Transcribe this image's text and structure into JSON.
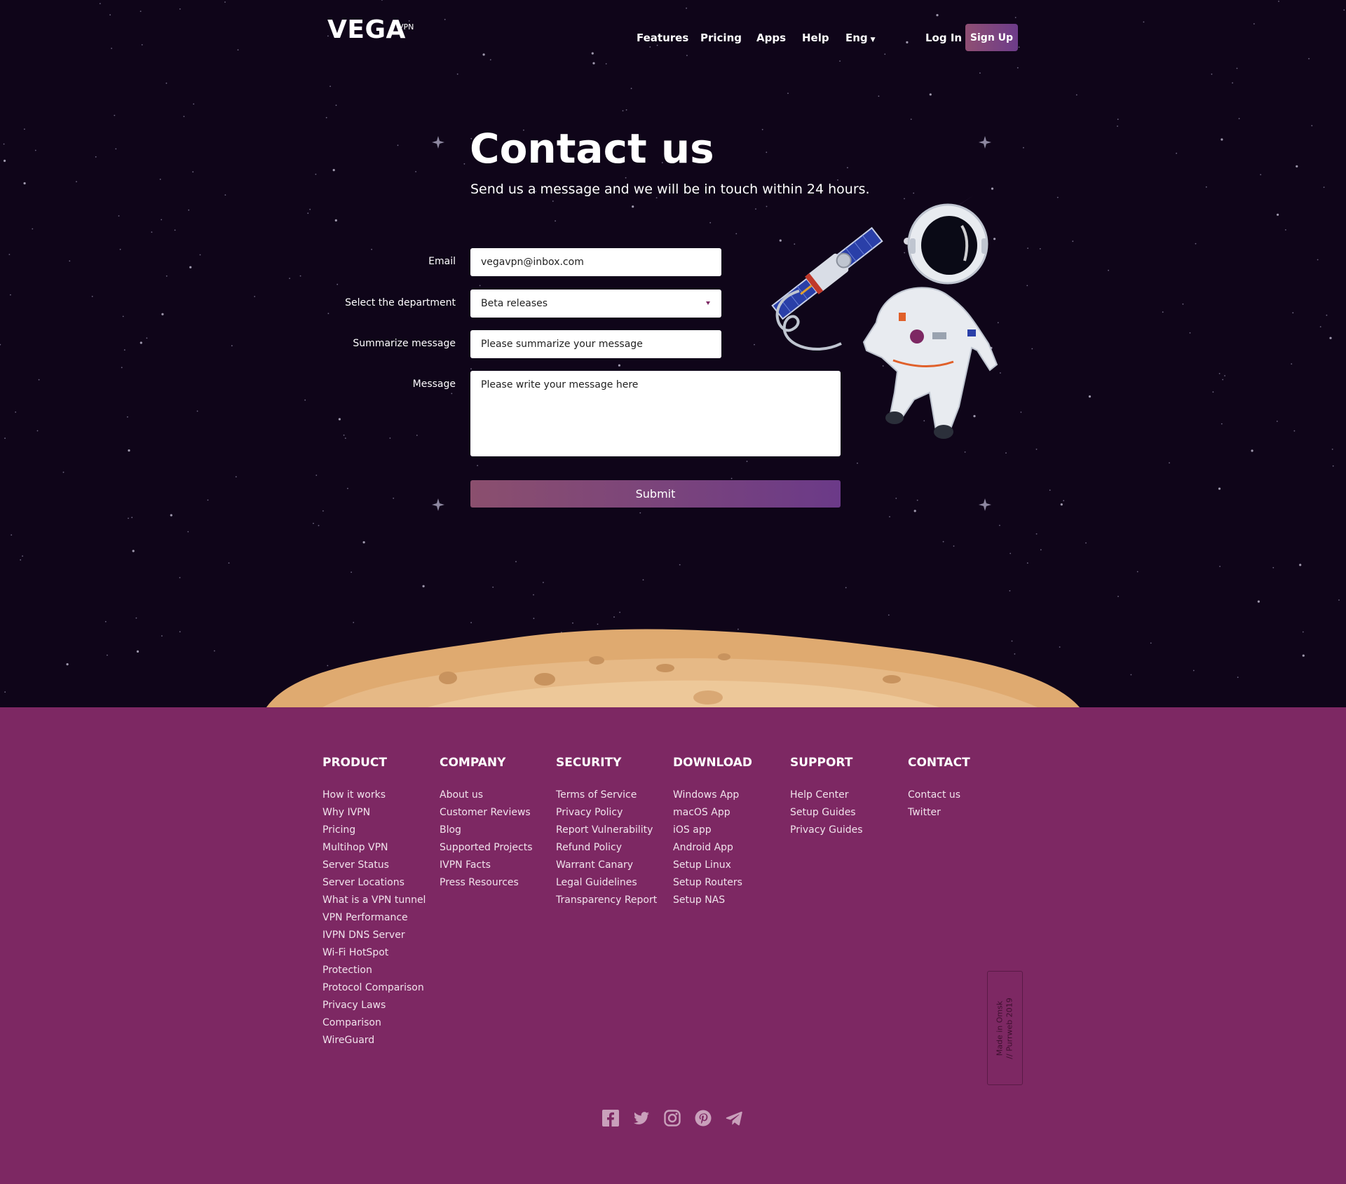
{
  "header": {
    "logo": "VEGA",
    "logo_sup": "VPN",
    "nav": [
      "Features",
      "Pricing",
      "Apps",
      "Help"
    ],
    "language": "Eng",
    "login": "Log In",
    "signup": "Sign Up"
  },
  "hero": {
    "title": "Contact us",
    "subtitle": "Send us a message and we will be in touch within 24 hours."
  },
  "form": {
    "email_label": "Email",
    "email_value": "vegavpn@inbox.com",
    "department_label": "Select the department",
    "department_value": "Beta releases",
    "summary_label": "Summarize message",
    "summary_placeholder": "Please summarize your message",
    "message_label": "Message",
    "message_placeholder": "Please write your message here",
    "submit": "Submit"
  },
  "footer": {
    "columns": [
      {
        "heading": "PRODUCT",
        "links": [
          "How it works",
          "Why IVPN",
          "Pricing",
          "Multihop VPN",
          "Server Status",
          "Server Locations",
          "What is a VPN tunnel",
          "VPN Performance",
          "IVPN DNS Server",
          "Wi-Fi HotSpot",
          "Protection",
          "Protocol Comparison",
          "Privacy Laws",
          "Comparison",
          "WireGuard"
        ]
      },
      {
        "heading": "COMPANY",
        "links": [
          "About us",
          "Customer Reviews",
          "Blog",
          "Supported Projects",
          "IVPN Facts",
          "Press Resources"
        ]
      },
      {
        "heading": "SECURITY",
        "links": [
          "Terms of Service",
          "Privacy Policy",
          "Report Vulnerability",
          "Refund Policy",
          "Warrant Canary",
          "Legal Guidelines",
          "Transparency Report"
        ]
      },
      {
        "heading": "DOWNLOAD",
        "links": [
          "Windows App",
          "macOS App",
          "iOS app",
          "Android App",
          "Setup Linux",
          "Setup Routers",
          "Setup NAS"
        ]
      },
      {
        "heading": "SUPPORT",
        "links": [
          "Help Center",
          "Setup Guides",
          "Privacy Guides"
        ]
      },
      {
        "heading": "CONTACT",
        "links": [
          "Contact us",
          "Twitter"
        ]
      }
    ],
    "badge_line1": "Made in Omsk",
    "badge_line2": "// Purrweb 2019",
    "socials": [
      "facebook-icon",
      "twitter-icon",
      "instagram-icon",
      "pinterest-icon",
      "telegram-icon"
    ]
  },
  "colors": {
    "space": "#0f0519",
    "footer": "#7d2863",
    "moon": "#e3b27a",
    "accent_start": "#8b4f6e",
    "accent_end": "#6b3a88"
  }
}
